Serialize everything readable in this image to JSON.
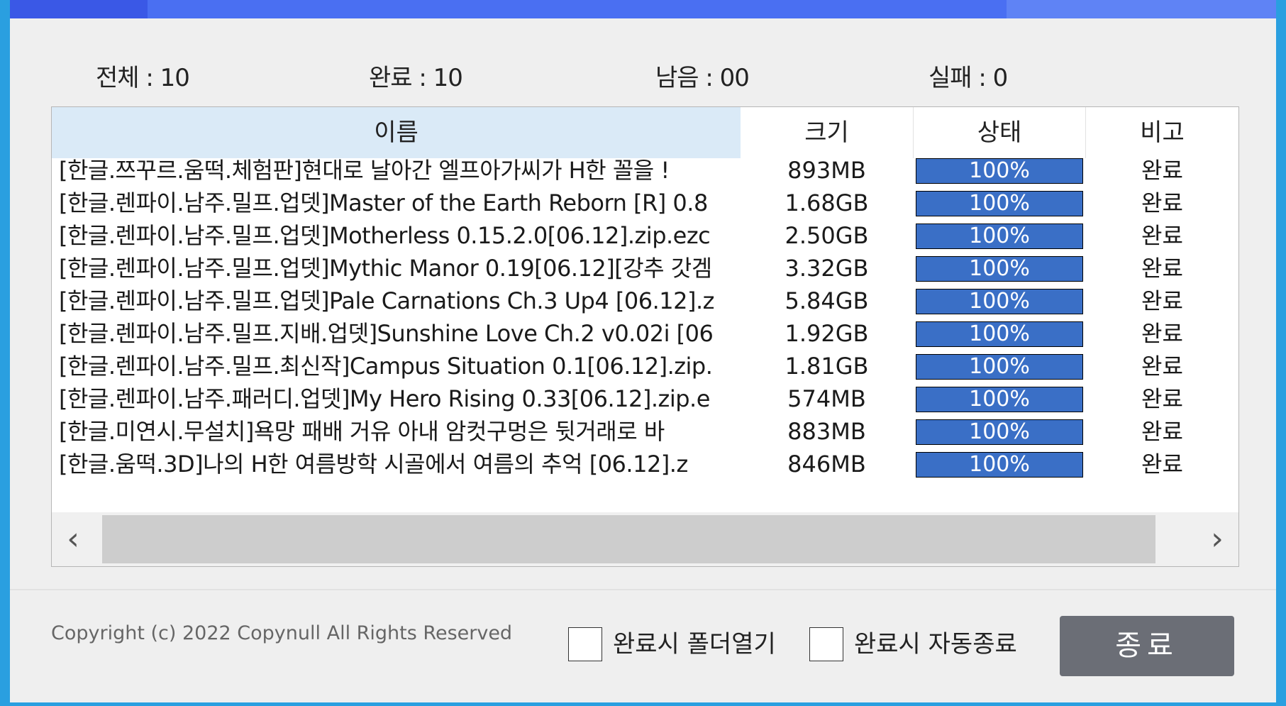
{
  "stats": {
    "total": "전체 : 10",
    "complete": "완료 : 10",
    "remaining": "남음 : 00",
    "failed": "실패 : 0"
  },
  "columns": {
    "name": "이름",
    "size": "크기",
    "status": "상태",
    "note": "비고"
  },
  "rows": [
    {
      "name": "[한글.쯔꾸르.움떡.체험판]현대로 날아간 엘프아가씨가 H한 꼴을 !",
      "size": "893MB",
      "progress": "100%",
      "note": "완료"
    },
    {
      "name": "[한글.렌파이.남주.밀프.업뎃]Master of the Earth Reborn [R] 0.8",
      "size": "1.68GB",
      "progress": "100%",
      "note": "완료"
    },
    {
      "name": "[한글.렌파이.남주.밀프.업뎃]Motherless 0.15.2.0[06.12].zip.ezc",
      "size": "2.50GB",
      "progress": "100%",
      "note": "완료"
    },
    {
      "name": "[한글.렌파이.남주.밀프.업뎃]Mythic Manor 0.19[06.12][강추 갓겜",
      "size": "3.32GB",
      "progress": "100%",
      "note": "완료"
    },
    {
      "name": "[한글.렌파이.남주.밀프.업뎃]Pale Carnations Ch.3 Up4 [06.12].z",
      "size": "5.84GB",
      "progress": "100%",
      "note": "완료"
    },
    {
      "name": "[한글.렌파이.남주.밀프.지배.업뎃]Sunshine Love Ch.2 v0.02i [06",
      "size": "1.92GB",
      "progress": "100%",
      "note": "완료"
    },
    {
      "name": "[한글.렌파이.남주.밀프.최신작]Campus Situation 0.1[06.12].zip.",
      "size": "1.81GB",
      "progress": "100%",
      "note": "완료"
    },
    {
      "name": "[한글.렌파이.남주.패러디.업뎃]My Hero Rising 0.33[06.12].zip.e",
      "size": "574MB",
      "progress": "100%",
      "note": "완료"
    },
    {
      "name": "[한글.미연시.무설치]욕망 패배 거유 아내 암컷구멍은 뒷거래로 바",
      "size": "883MB",
      "progress": "100%",
      "note": "완료"
    },
    {
      "name": "[한글.움떡.3D]나의 H한 여름방학 시골에서 여름의 추억 [06.12].z",
      "size": "846MB",
      "progress": "100%",
      "note": "완료"
    }
  ],
  "scrollbar": {
    "left_arrow": "‹",
    "right_arrow": "›"
  },
  "footer": {
    "copyright": "Copyright (c) 2022 Copynull All Rights Reserved",
    "open_folder_label": "완료시 폴더열기",
    "auto_exit_label": "완료시 자동종료",
    "close_button": "종료"
  },
  "colors": {
    "titlebar": "#4a6ff2",
    "progress_fill": "#3a6fc6",
    "header_name_bg": "#daeaf7",
    "close_button_bg": "#6b6e76"
  }
}
